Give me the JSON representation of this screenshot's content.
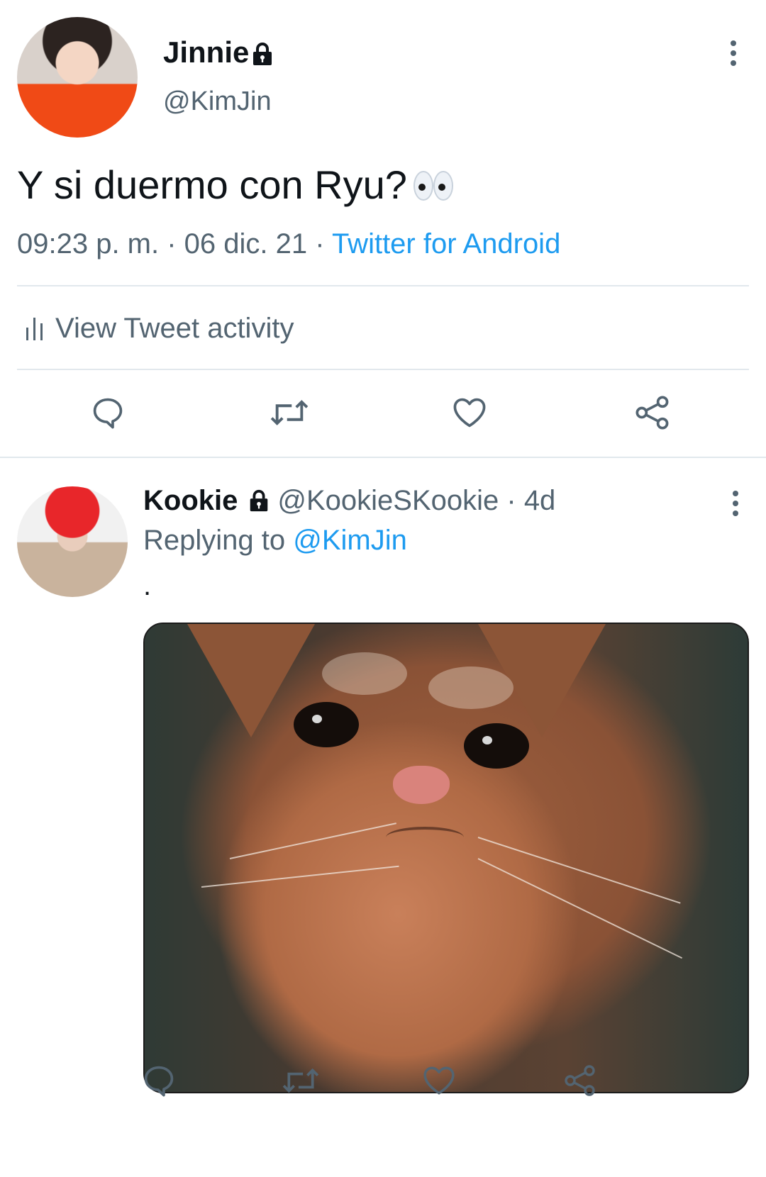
{
  "main_tweet": {
    "author_name": "Jinnie",
    "handle": "@KimJin",
    "text": "Y si duermo con Ryu?",
    "emoji_icon": "eyes-emoji-icon",
    "timestamp": "09:23 p. m. · 06 dic. 21 · ",
    "source": "Twitter for Android",
    "activity_label": "View Tweet activity",
    "actions": [
      "reply-icon",
      "retweet-icon",
      "like-icon",
      "share-icon"
    ]
  },
  "reply_tweet": {
    "author_name": "Kookie",
    "handle": "@KookieSKookie",
    "time_ago": " · 4d",
    "replying_prefix": "Replying to ",
    "replying_to": "@KimJin",
    "text": ".",
    "media_alt": "cat photo",
    "actions": [
      "reply-icon",
      "retweet-icon",
      "like-icon",
      "share-icon"
    ]
  },
  "colors": {
    "link": "#1d9bf0",
    "secondary_text": "#536471",
    "divider": "#e1e8ed",
    "icon": "#536471"
  }
}
